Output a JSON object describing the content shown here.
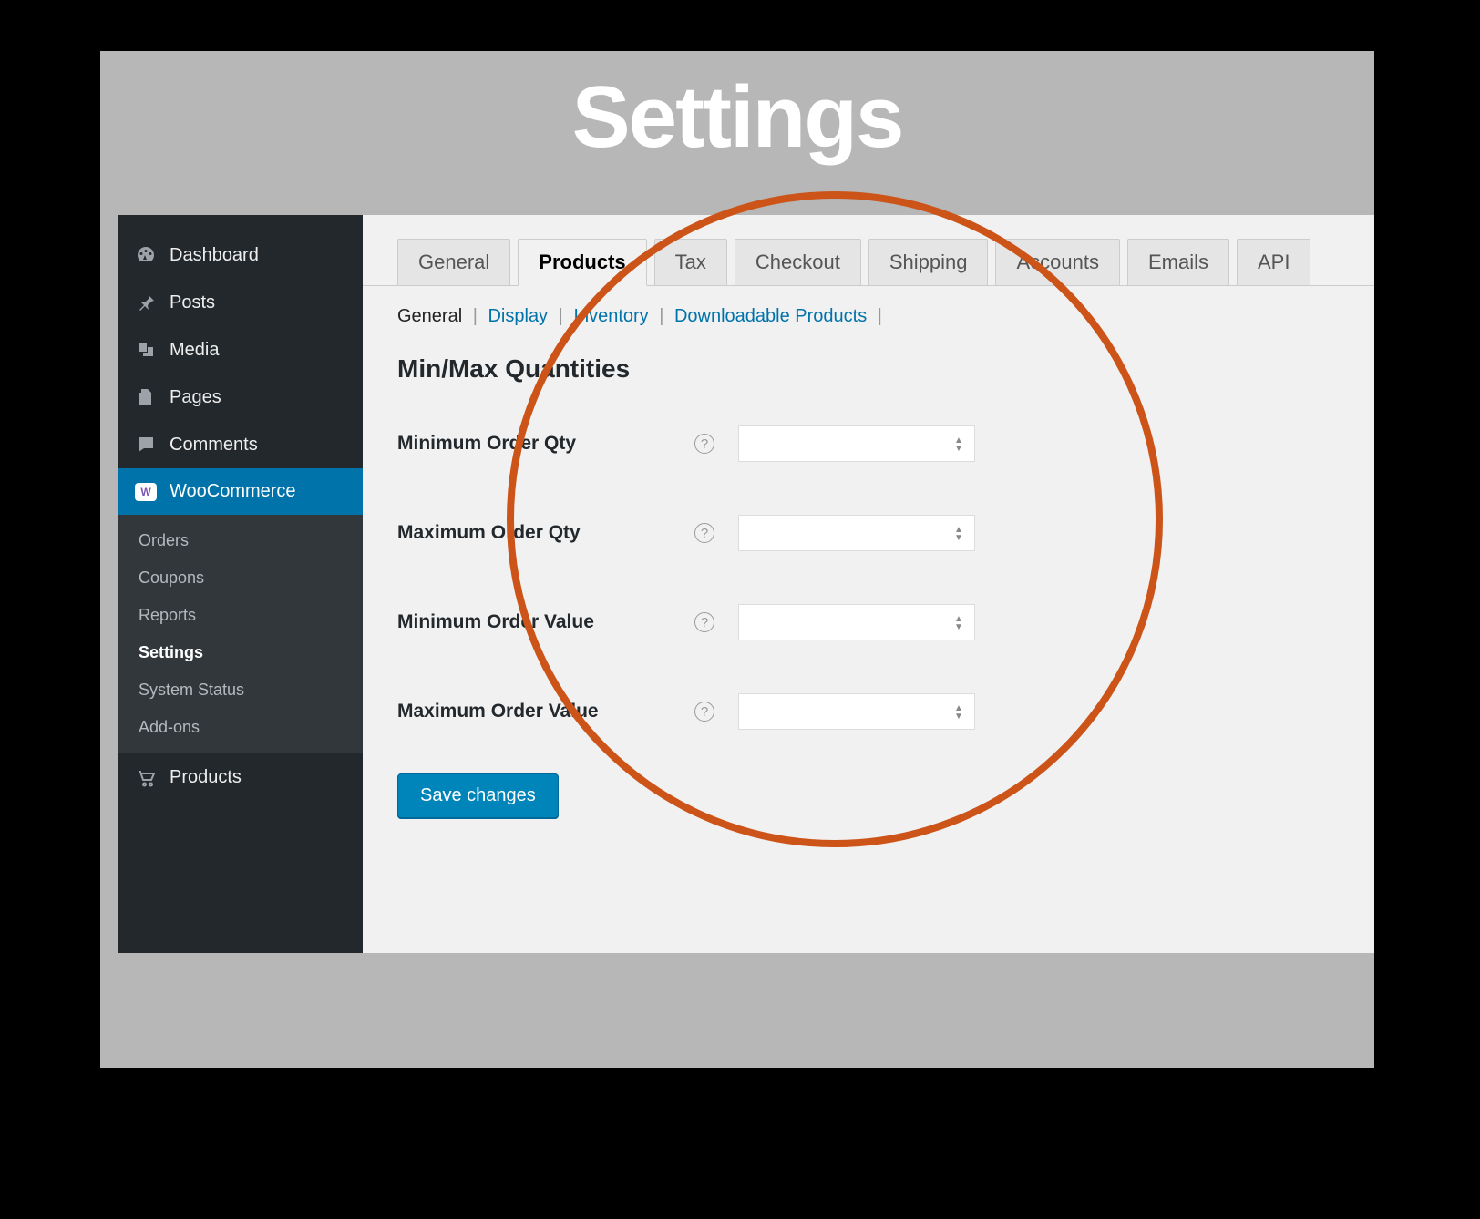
{
  "frame": {
    "title": "Settings"
  },
  "sidebar": {
    "items": [
      {
        "label": "Dashboard",
        "icon": "dashboard"
      },
      {
        "label": "Posts",
        "icon": "pin"
      },
      {
        "label": "Media",
        "icon": "media"
      },
      {
        "label": "Pages",
        "icon": "pages"
      },
      {
        "label": "Comments",
        "icon": "comment"
      },
      {
        "label": "WooCommerce",
        "icon": "woo",
        "active": true
      },
      {
        "label": "Products",
        "icon": "cart"
      }
    ],
    "sub_items": [
      {
        "label": "Orders"
      },
      {
        "label": "Coupons"
      },
      {
        "label": "Reports"
      },
      {
        "label": "Settings",
        "current": true
      },
      {
        "label": "System Status"
      },
      {
        "label": "Add-ons"
      }
    ]
  },
  "tabs": [
    {
      "label": "General"
    },
    {
      "label": "Products",
      "active": true
    },
    {
      "label": "Tax"
    },
    {
      "label": "Checkout"
    },
    {
      "label": "Shipping"
    },
    {
      "label": "Accounts"
    },
    {
      "label": "Emails"
    },
    {
      "label": "API"
    }
  ],
  "subtabs": [
    {
      "label": "General",
      "current": true
    },
    {
      "label": "Display"
    },
    {
      "label": "Inventory"
    },
    {
      "label": "Downloadable Products"
    }
  ],
  "section": {
    "title": "Min/Max Quantities"
  },
  "fields": [
    {
      "label": "Minimum Order Qty",
      "value": ""
    },
    {
      "label": "Maximum Order Qty",
      "value": ""
    },
    {
      "label": "Minimum Order Value",
      "value": ""
    },
    {
      "label": "Maximum Order Value",
      "value": ""
    }
  ],
  "buttons": {
    "save": "Save changes"
  },
  "woo_badge": "W",
  "colors": {
    "accent": "#0073aa",
    "save": "#0085ba",
    "annotation": "#cc5418"
  }
}
